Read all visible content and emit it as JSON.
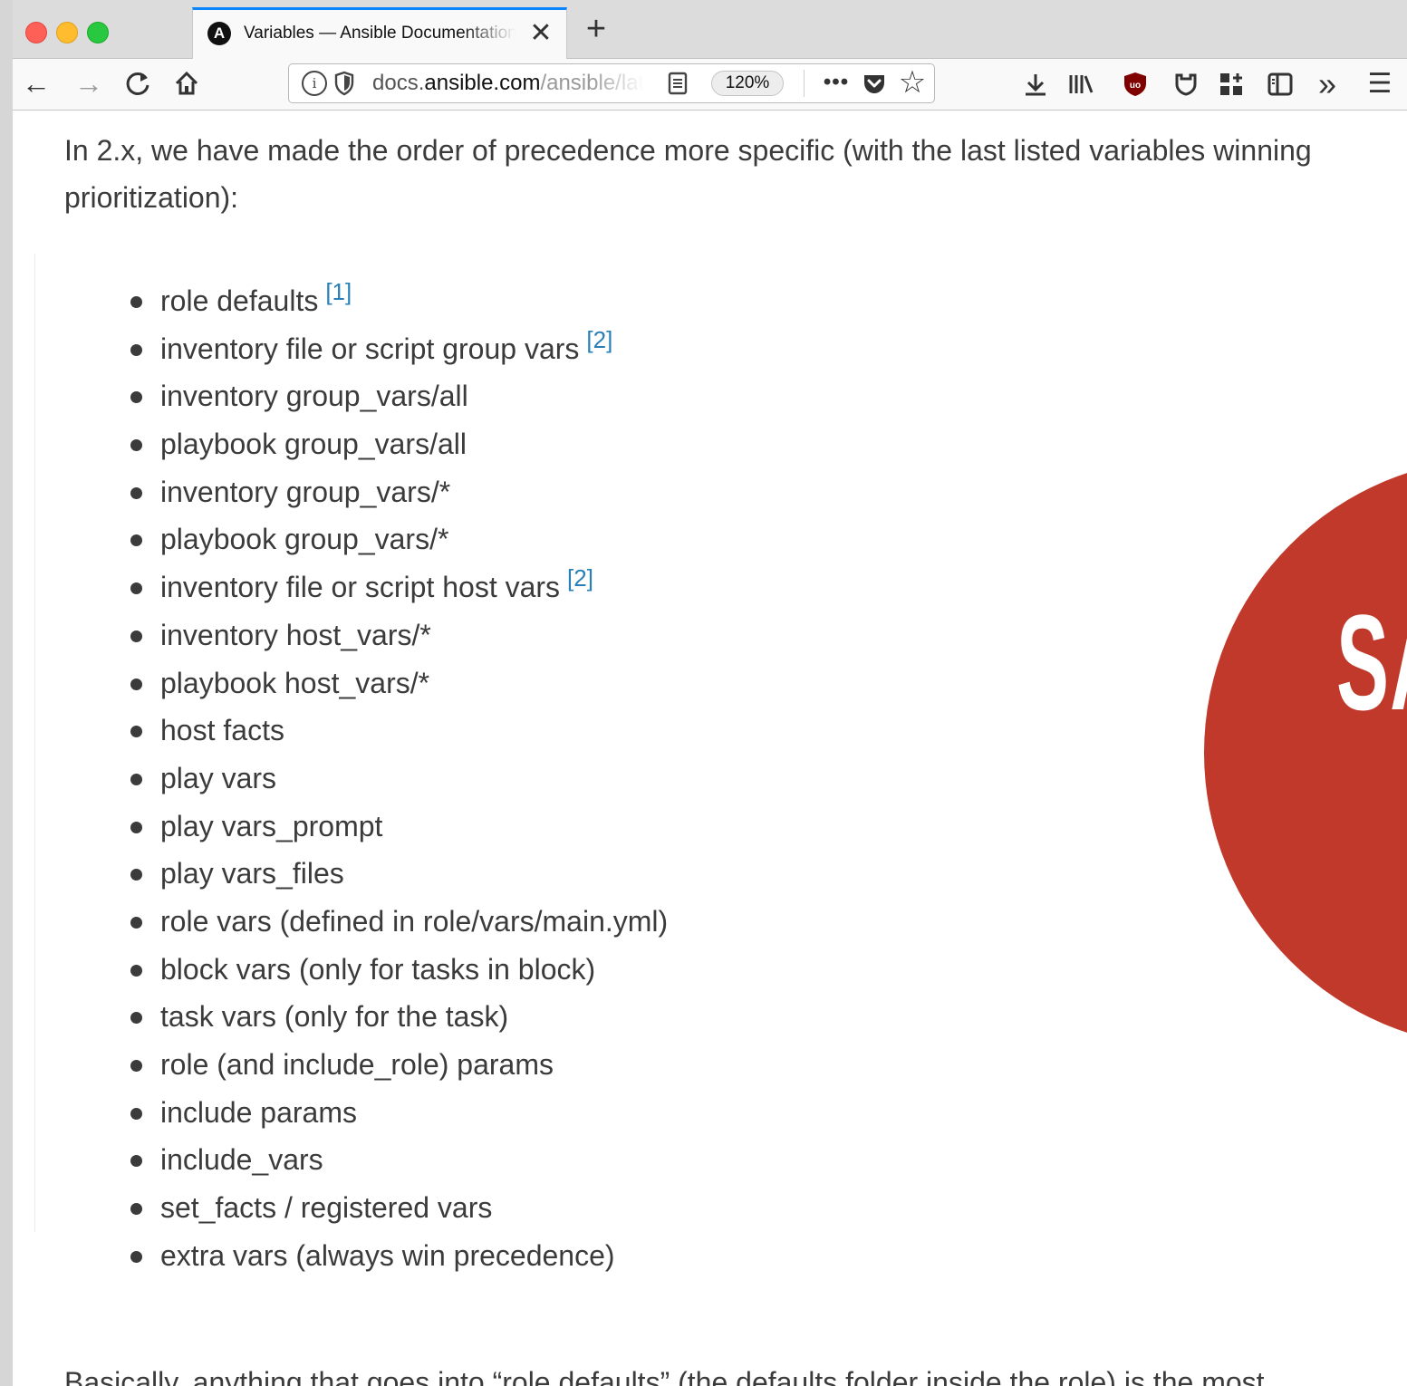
{
  "browser": {
    "tab": {
      "favicon_letter": "A",
      "title": "Variables — Ansible Documentation",
      "close_glyph": "✕"
    },
    "new_tab_glyph": "+",
    "nav": {
      "back_glyph": "←",
      "forward_glyph": "→",
      "reload_glyph": "C",
      "home_glyph": "⌂"
    },
    "url": {
      "domain_prefix": "docs.",
      "domain": "ansible.com",
      "path": "/ansible/latest/playbooks_variables.html",
      "zoom": "120%"
    },
    "toolbar": {
      "more_glyph": "•••",
      "bookmark_glyph": "☆",
      "overflow_glyph": "»",
      "menu_glyph": "☰"
    },
    "icons": [
      "info-icon",
      "tracking-shield-icon",
      "reader-view-icon",
      "pocket-icon",
      "star-icon",
      "download-icon",
      "library-icon",
      "ublock-icon",
      "extension-icon",
      "container-icon",
      "sidebar-icon",
      "overflow-icon",
      "hamburger-menu-icon"
    ]
  },
  "content": {
    "intro": "In 2.x, we have made the order of precedence more specific (with the last listed variables winning prioritization):",
    "precedence": [
      {
        "text": "role defaults",
        "footnote": "[1]"
      },
      {
        "text": "inventory file or script group vars",
        "footnote": "[2]"
      },
      {
        "text": "inventory group_vars/all",
        "footnote": ""
      },
      {
        "text": "playbook group_vars/all",
        "footnote": ""
      },
      {
        "text": "inventory group_vars/*",
        "footnote": ""
      },
      {
        "text": "playbook group_vars/*",
        "footnote": ""
      },
      {
        "text": "inventory file or script host vars",
        "footnote": "[2]"
      },
      {
        "text": "inventory host_vars/*",
        "footnote": ""
      },
      {
        "text": "playbook host_vars/*",
        "footnote": ""
      },
      {
        "text": "host facts",
        "footnote": ""
      },
      {
        "text": "play vars",
        "footnote": ""
      },
      {
        "text": "play vars_prompt",
        "footnote": ""
      },
      {
        "text": "play vars_files",
        "footnote": ""
      },
      {
        "text": "role vars (defined in role/vars/main.yml)",
        "footnote": ""
      },
      {
        "text": "block vars (only for tasks in block)",
        "footnote": ""
      },
      {
        "text": "task vars (only for the task)",
        "footnote": ""
      },
      {
        "text": "role (and include_role) params",
        "footnote": ""
      },
      {
        "text": "include params",
        "footnote": ""
      },
      {
        "text": "include_vars",
        "footnote": ""
      },
      {
        "text": "set_facts / registered vars",
        "footnote": ""
      },
      {
        "text": "extra vars (always win precedence)",
        "footnote": ""
      }
    ],
    "outro": "Basically, anything that goes into “role defaults” (the defaults folder inside the role) is the most",
    "badge_text": "SA",
    "badge_color": "#c0392b",
    "link_color": "#2980b9"
  }
}
